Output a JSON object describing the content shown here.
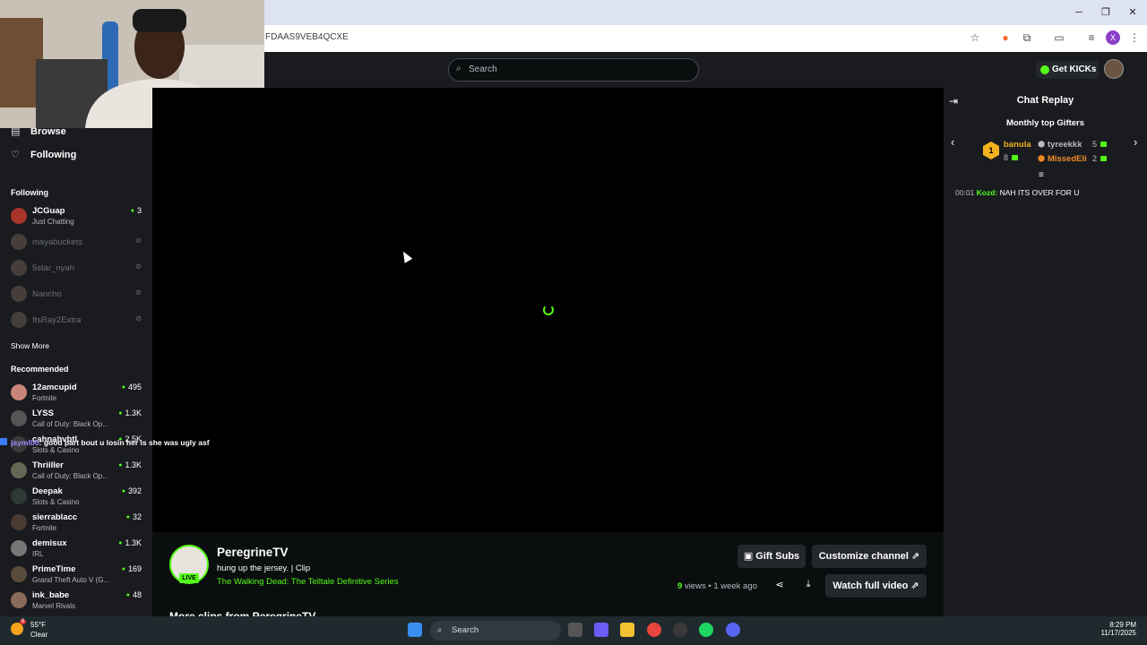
{
  "browser": {
    "url": "FDAAS9VEB4QCXE",
    "window_controls": [
      "minimize",
      "restore",
      "close"
    ]
  },
  "kick_header": {
    "search_placeholder": "Search",
    "get_kicks_label": "Get KICKs"
  },
  "sidebar": {
    "nav": [
      {
        "label": "Browse",
        "icon": "browse-icon"
      },
      {
        "label": "Following",
        "icon": "heart-icon"
      }
    ],
    "following_heading": "Following",
    "following": [
      {
        "name": "JCGuap",
        "category": "Just Chatting",
        "viewers": "3",
        "live": true
      },
      {
        "name": "mayabuckets",
        "live": false
      },
      {
        "name": "5star_nyah",
        "live": false
      },
      {
        "name": "Nancho",
        "live": false
      },
      {
        "name": "ItsRay2Extra",
        "live": false
      }
    ],
    "show_more": "Show More",
    "recommended_heading": "Recommended",
    "recommended": [
      {
        "name": "12amcupid",
        "category": "Fortnite",
        "viewers": "495"
      },
      {
        "name": "LYSS",
        "category": "Call of Duty: Black Op...",
        "viewers": "1.3K"
      },
      {
        "name": "cahnahvbtl",
        "category": "Slots & Casino",
        "viewers": "2.5K"
      },
      {
        "name": "Thriiller",
        "category": "Call of Duty: Black Op...",
        "viewers": "1.3K"
      },
      {
        "name": "Deepak",
        "category": "Slots & Casino",
        "viewers": "392"
      },
      {
        "name": "sierrablacc",
        "category": "Fortnite",
        "viewers": "32"
      },
      {
        "name": "demisux",
        "category": "IRL",
        "viewers": "1.3K"
      },
      {
        "name": "PrimeTime",
        "category": "Grand Theft Auto V (G...",
        "viewers": "169"
      },
      {
        "name": "ink_babe",
        "category": "Marvel Rivals",
        "viewers": "48"
      }
    ]
  },
  "overlay_chat": {
    "user": "jaymlb6",
    "message": "good part bout u losin her is she was ugly asf"
  },
  "stream": {
    "streamer": "PeregrineTV",
    "live_badge": "LIVE",
    "clip_title": "hung up the jersey. | Clip",
    "game": "The Walking Dead: The Telltale Definitive Series",
    "gift_subs": "Gift Subs",
    "customize": "Customize channel",
    "views_count": "9",
    "views_label": "views",
    "time_ago": "1 week ago",
    "watch_full": "Watch full video",
    "more_clips": "More clips from PeregrineTV"
  },
  "chat": {
    "title": "Chat Replay",
    "gifters_title": "Monthly top Gifters",
    "gifters": [
      {
        "rank": "1",
        "name": "banula",
        "count": "8",
        "color": "#f2b31f"
      },
      {
        "rank": "2",
        "name": "tyreekkk",
        "count": "5",
        "color": "#b7b9bd"
      },
      {
        "rank": "3",
        "name": "MissedEli",
        "count": "2",
        "color": "#f08a24"
      }
    ],
    "message": {
      "time": "00:01",
      "user": "Kozd:",
      "text": "NAH ITS OVER FOR U"
    }
  },
  "taskbar": {
    "weather_temp": "55°F",
    "weather_cond": "Clear",
    "weather_badge": "6",
    "search": "Search",
    "time": "8:29 PM",
    "date": "11/17/2025"
  }
}
